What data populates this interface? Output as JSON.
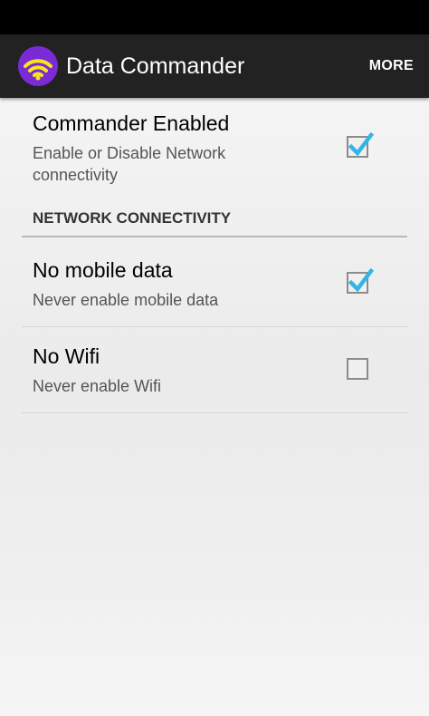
{
  "app_bar": {
    "title": "Data Commander",
    "more_label": "MORE",
    "icon": "wifi-icon",
    "icon_background": "#7a2bd6",
    "icon_color": "#f7e81a"
  },
  "preferences": {
    "commander": {
      "title": "Commander Enabled",
      "summary": "Enable or Disable Network connectivity",
      "checked": true
    },
    "section_header": "NETWORK CONNECTIVITY",
    "no_mobile_data": {
      "title": "No mobile data",
      "summary": "Never enable mobile data",
      "checked": true
    },
    "no_wifi": {
      "title": "No Wifi",
      "summary": "Never enable Wifi",
      "checked": false
    }
  },
  "colors": {
    "accent_check": "#33b5e5",
    "action_bar": "#222222"
  }
}
